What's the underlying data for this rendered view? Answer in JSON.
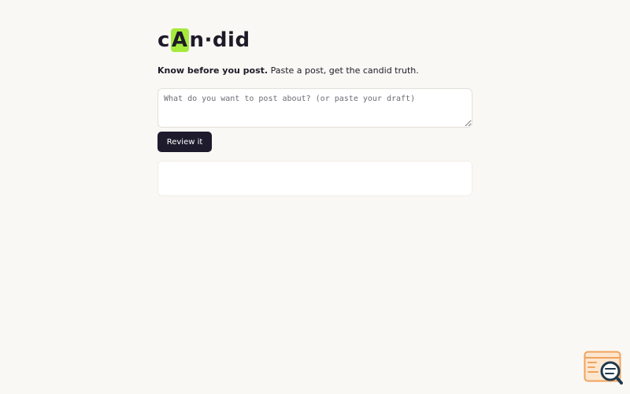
{
  "logo": {
    "pre": "c",
    "highlight": "A",
    "post": "n·did",
    "highlight_color": "#a6ea3d"
  },
  "tagline": {
    "bold": "Know before you post.",
    "rest": " Paste a post, get the candid truth."
  },
  "draft": {
    "placeholder": "What do you want to post about? (or paste your draft)",
    "value": ""
  },
  "review_button": {
    "label": "Review it",
    "color": "#1e1b2d"
  },
  "result": {
    "text": ""
  },
  "widget": {
    "icon": "search-window-icon",
    "accent": "#f0a35e"
  },
  "colors": {
    "background": "#faf8f4",
    "text": "#1e1b29"
  }
}
